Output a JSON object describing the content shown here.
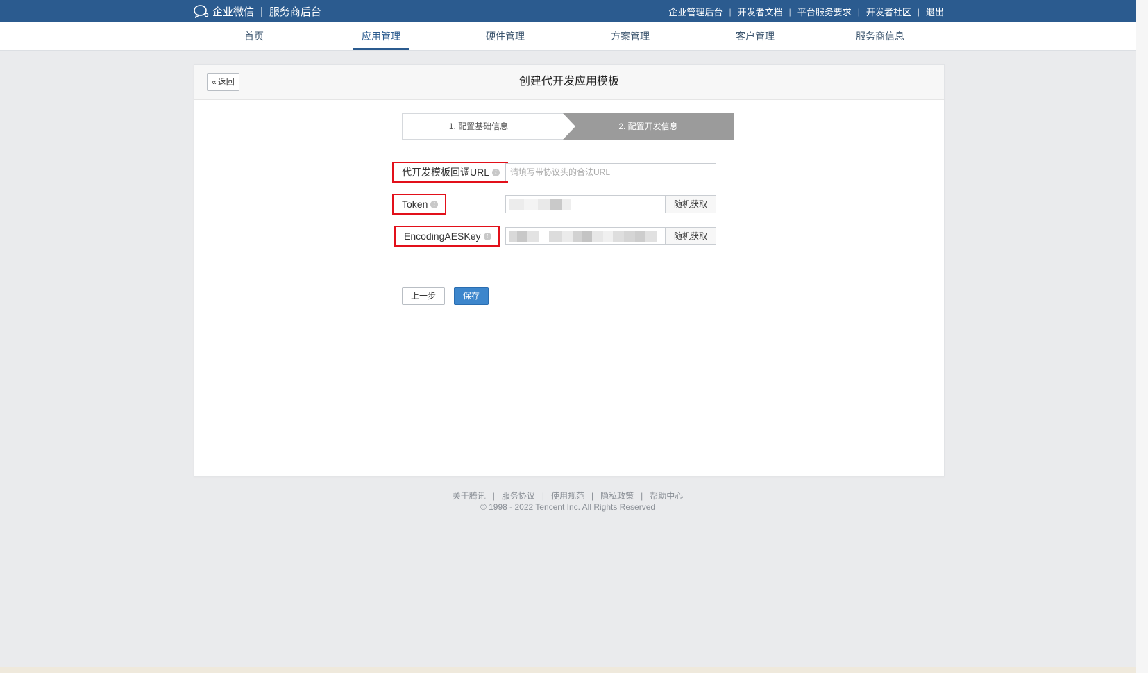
{
  "topbar": {
    "brand": "企业微信",
    "separator": "|",
    "sub_brand": "服务商后台",
    "links": [
      "企业管理后台",
      "开发者文档",
      "平台服务要求",
      "开发者社区",
      "退出"
    ],
    "bar": "|",
    "bg_color": "#2b5b8f"
  },
  "nav": {
    "items": [
      "首页",
      "应用管理",
      "硬件管理",
      "方案管理",
      "客户管理",
      "服务商信息"
    ],
    "active_index": 1
  },
  "card": {
    "back_label": "返回",
    "title": "创建代开发应用模板"
  },
  "steps": {
    "step1": "1. 配置基础信息",
    "step2": "2. 配置开发信息",
    "active": 2
  },
  "form": {
    "url_label": "代开发模板回调URL",
    "url_placeholder": "请填写带协议头的合法URL",
    "url_value": "",
    "token_label": "Token",
    "aes_label": "EncodingAESKey",
    "random_label": "随机获取",
    "info_icon": "i",
    "highlight_color": "#e2101a"
  },
  "actions": {
    "prev_label": "上一步",
    "save_label": "保存"
  },
  "footer": {
    "links": [
      "关于腾讯",
      "服务协议",
      "使用规范",
      "隐私政策",
      "帮助中心"
    ],
    "bar": "|",
    "copyright": "© 1998 - 2022 Tencent Inc. All Rights Reserved"
  }
}
